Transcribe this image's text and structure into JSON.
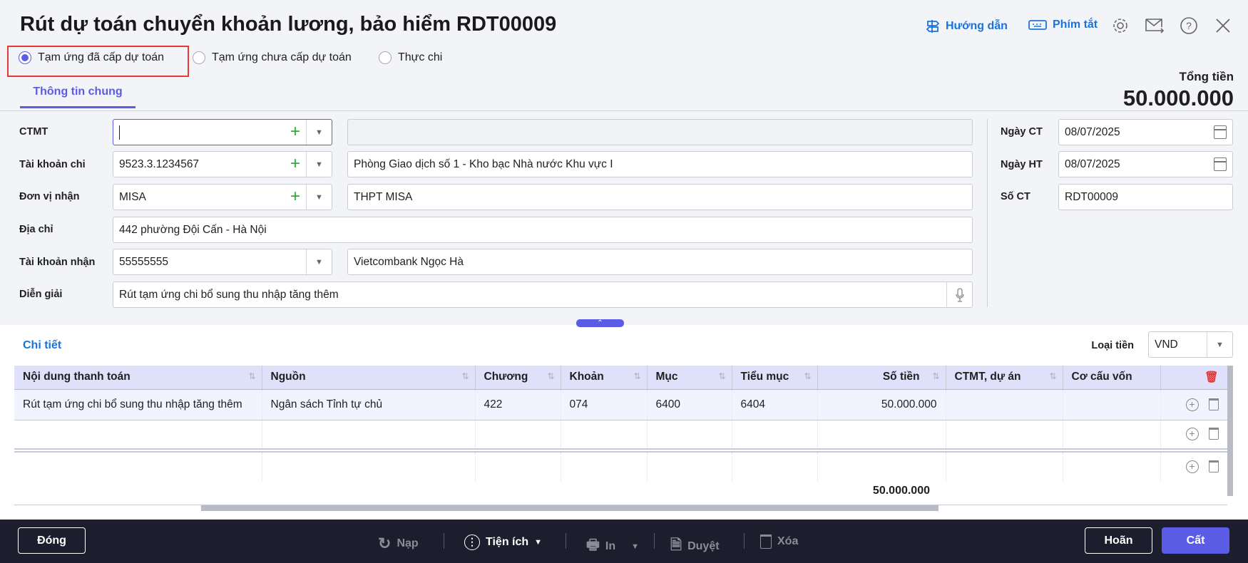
{
  "header": {
    "title": "Rút dự toán chuyển khoản lương, bảo hiểm RDT00009",
    "guide": "Hướng dẫn",
    "shortcuts": "Phím tắt"
  },
  "modes": [
    {
      "label": "Tạm ứng đã cấp dự toán",
      "selected": true
    },
    {
      "label": "Tạm ứng chưa cấp dự toán",
      "selected": false
    },
    {
      "label": "Thực chi",
      "selected": false
    }
  ],
  "tabs": {
    "general": "Thông tin chung"
  },
  "total": {
    "label": "Tổng tiền",
    "value": "50.000.000"
  },
  "form": {
    "ctmt": {
      "label": "CTMT",
      "value": "",
      "name": ""
    },
    "account": {
      "label": "Tài khoản chi",
      "value": "9523.3.1234567",
      "name": "Phòng Giao dịch số 1 - Kho bạc Nhà nước Khu vực I"
    },
    "receiver": {
      "label": "Đơn vị nhận",
      "value": "MISA",
      "name": "THPT MISA"
    },
    "address": {
      "label": "Địa chỉ",
      "value": "442 phường Đội Cấn - Hà Nội"
    },
    "recv_account": {
      "label": "Tài khoản nhận",
      "value": "55555555",
      "name": "Vietcombank Ngọc Hà"
    },
    "description": {
      "label": "Diễn giải",
      "value": "Rút tạm ứng chi bổ sung thu nhập tăng thêm"
    },
    "date_ct": {
      "label": "Ngày CT",
      "value": "08/07/2025"
    },
    "date_ht": {
      "label": "Ngày HT",
      "value": "08/07/2025"
    },
    "number": {
      "label": "Số CT",
      "value": "RDT00009"
    }
  },
  "detail": {
    "title": "Chi tiết",
    "currency_label": "Loại tiền",
    "currency": "VND",
    "columns": [
      "Nội dung thanh toán",
      "Nguồn",
      "Chương",
      "Khoản",
      "Mục",
      "Tiểu mục",
      "Số tiền",
      "CTMT, dự án",
      "Cơ cấu vốn"
    ],
    "rows": [
      [
        "Rút tạm ứng chi bổ sung thu nhập tăng thêm",
        "Ngân sách Tỉnh tự chủ",
        "422",
        "074",
        "6400",
        "6404",
        "50.000.000",
        "",
        ""
      ]
    ],
    "total": "50.000.000"
  },
  "footer": {
    "close": "Đóng",
    "reload": "Nạp",
    "utilities": "Tiện ích",
    "print": "In",
    "approve": "Duyệt",
    "delete": "Xóa",
    "cancel": "Hoãn",
    "save": "Cất"
  }
}
